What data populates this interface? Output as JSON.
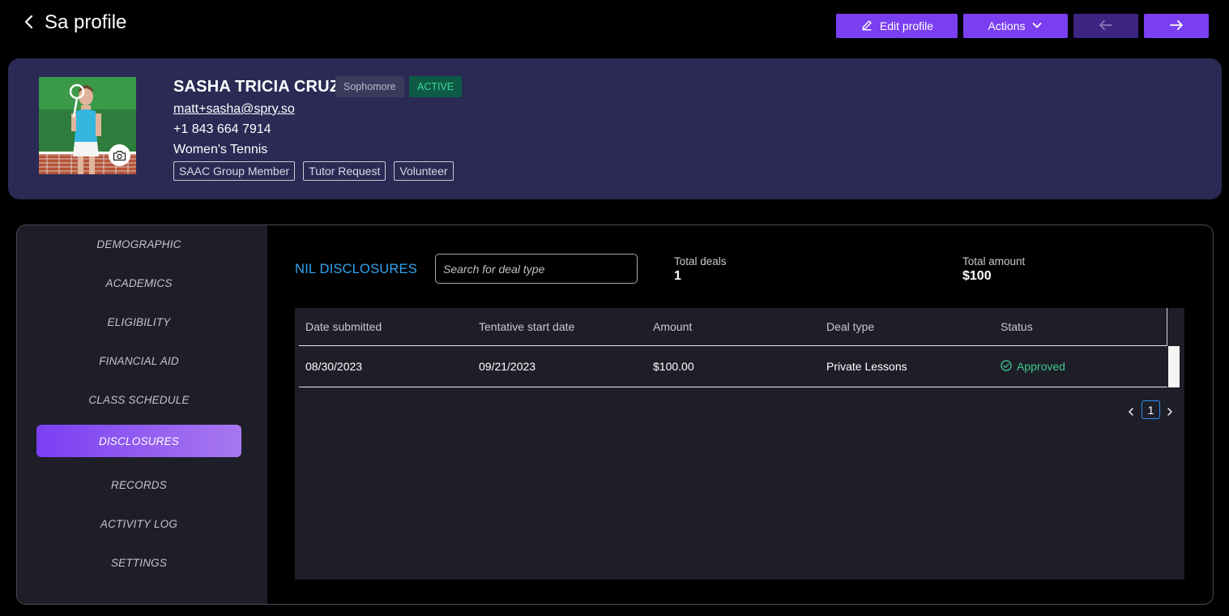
{
  "header": {
    "title": "Sa profile",
    "edit_label": "Edit profile",
    "actions_label": "Actions"
  },
  "profile": {
    "name": "SASHA TRICIA CRUZ",
    "year": "Sophomore",
    "status": "ACTIVE",
    "email": "matt+sasha@spry.so",
    "phone": "+1 843 664 7914",
    "sport": "Women's Tennis",
    "tags": [
      "SAAC Group Member",
      "Tutor Request",
      "Volunteer"
    ]
  },
  "sidebar": {
    "items": [
      {
        "label": "DEMOGRAPHIC"
      },
      {
        "label": "ACADEMICS"
      },
      {
        "label": "ELIGIBILITY"
      },
      {
        "label": "FINANCIAL AID"
      },
      {
        "label": "CLASS SCHEDULE"
      },
      {
        "label": "DISCLOSURES"
      },
      {
        "label": "RECORDS"
      },
      {
        "label": "ACTIVITY LOG"
      },
      {
        "label": "SETTINGS"
      }
    ],
    "active": "DISCLOSURES"
  },
  "disclosures": {
    "title": "NIL DISCLOSURES",
    "search_placeholder": "Search for deal type",
    "total_deals_label": "Total deals",
    "total_deals_value": "1",
    "total_amount_label": "Total amount",
    "total_amount_value": "$100",
    "columns": [
      "Date submitted",
      "Tentative start date",
      "Amount",
      "Deal type",
      "Status"
    ],
    "rows": [
      {
        "date_submitted": "08/30/2023",
        "start_date": "09/21/2023",
        "amount": "$100.00",
        "deal_type": "Private Lessons",
        "status": "Approved"
      }
    ],
    "page": "1"
  },
  "colors": {
    "accent": "#7b3ff2",
    "card": "#2a2a55",
    "link_blue": "#33a4ef",
    "approved_green": "#3fc891"
  }
}
